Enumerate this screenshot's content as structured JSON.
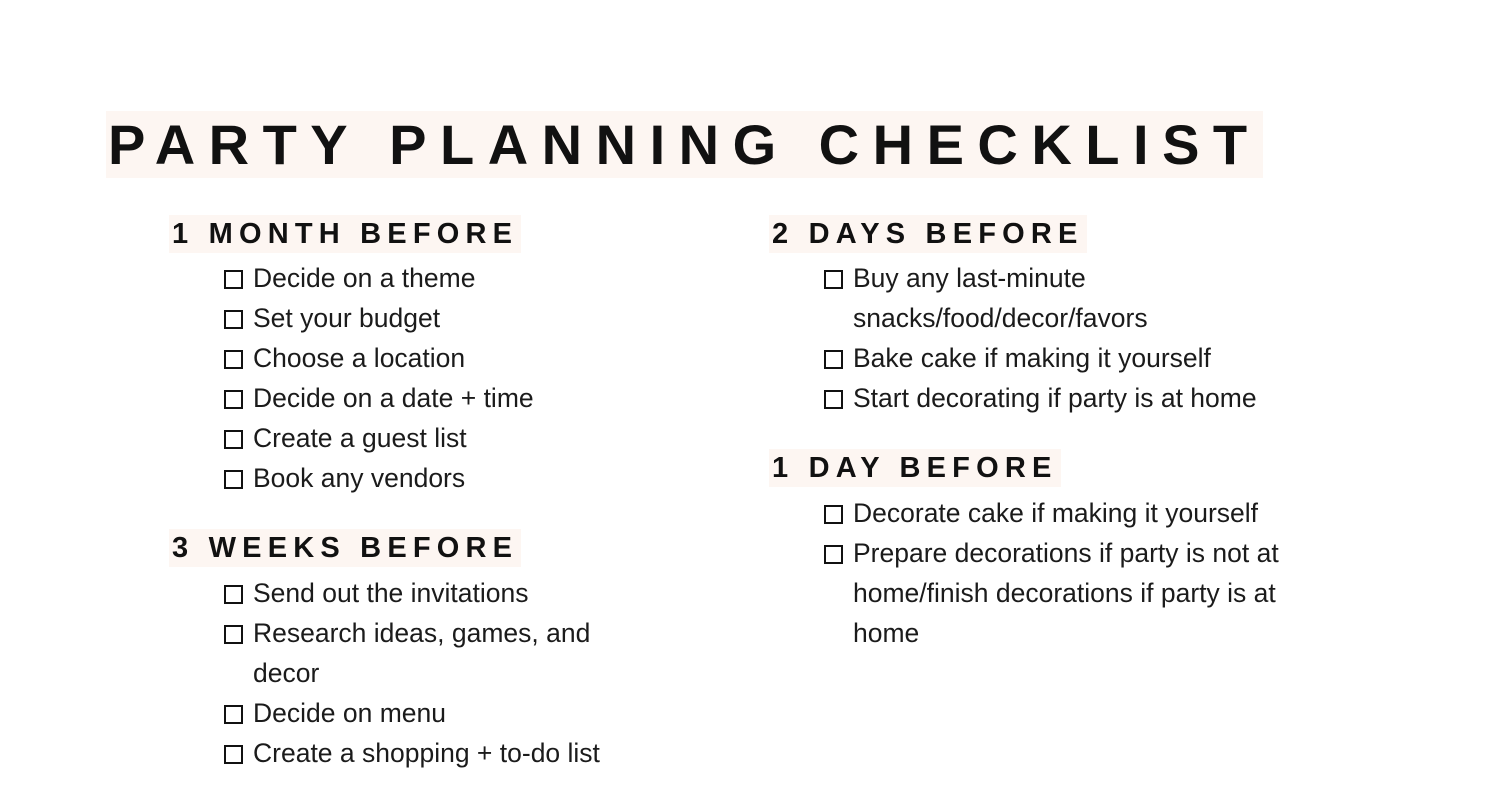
{
  "document": {
    "title": "PARTY PLANNING CHECKLIST",
    "background_color": "#ffffff",
    "text_color": "#1a1a1a",
    "highlight_color": "#fdf6f2"
  },
  "columns": {
    "left": [
      {
        "heading": "1 MONTH BEFORE",
        "items": [
          "Decide on a theme",
          "Set your budget",
          "Choose a location",
          "Decide on a date + time",
          "Create a guest list",
          "Book any vendors"
        ]
      },
      {
        "heading": "3 WEEKS BEFORE",
        "items": [
          "Send out the invitations",
          "Research ideas, games, and decor",
          "Decide on menu",
          "Create a shopping + to-do list"
        ]
      }
    ],
    "right": [
      {
        "heading": "2 DAYS BEFORE",
        "items": [
          "Buy any last-minute snacks/food/decor/favors",
          "Bake cake if making it yourself",
          "Start decorating if party is at home"
        ]
      },
      {
        "heading": "1 DAY BEFORE",
        "items": [
          "Decorate cake if making it yourself",
          "Prepare decorations if party is not at home/finish decorations if party is at home"
        ]
      }
    ]
  },
  "icons": {
    "checkbox": "checkbox-empty-icon"
  }
}
